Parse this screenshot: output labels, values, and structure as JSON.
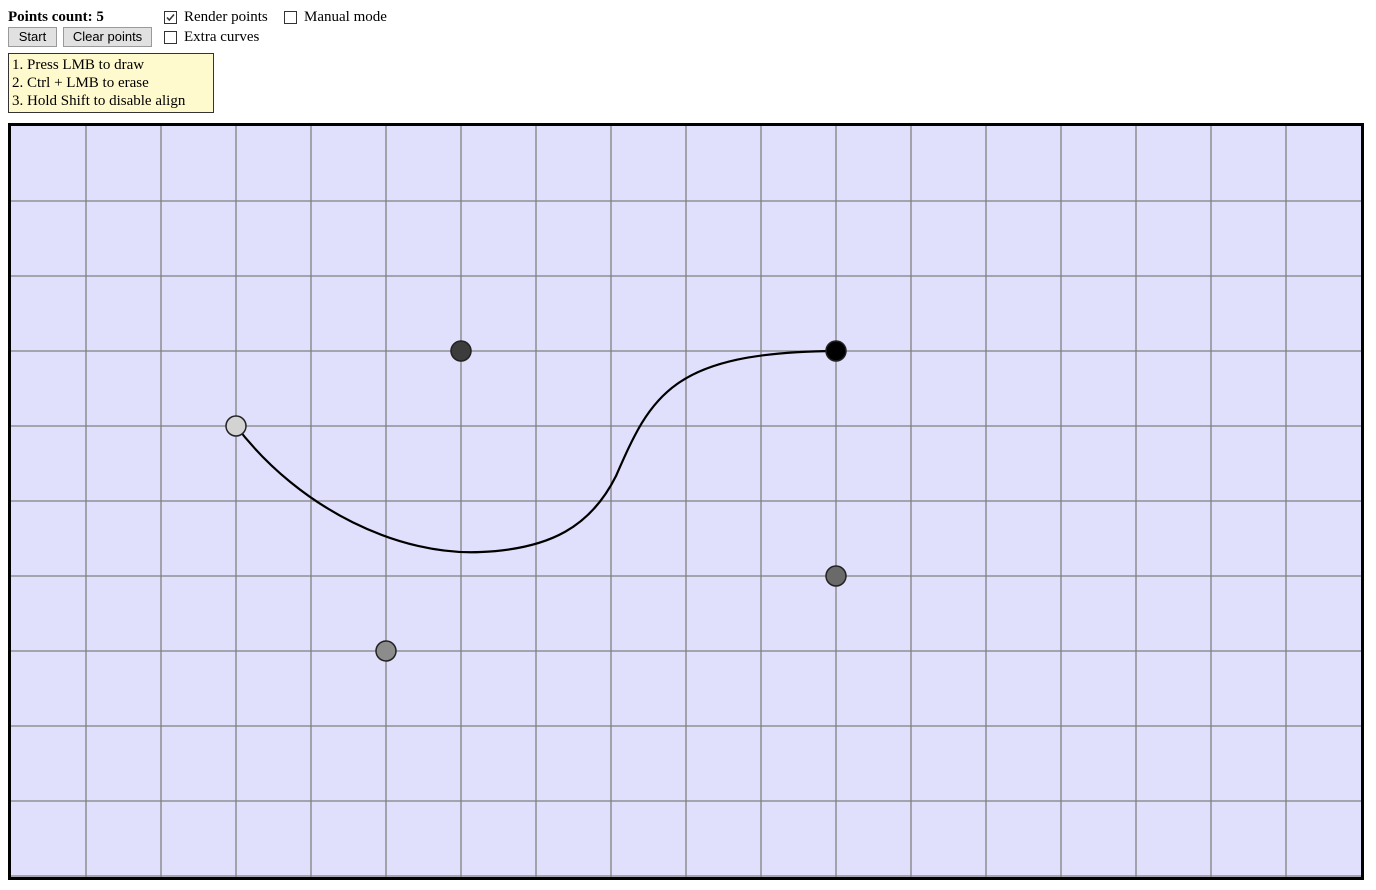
{
  "header": {
    "points_count_label": "Points count: 5"
  },
  "buttons": {
    "start_label": "Start",
    "clear_label": "Clear points"
  },
  "options": {
    "render_points": {
      "label": "Render points",
      "checked": true
    },
    "manual_mode": {
      "label": "Manual mode",
      "checked": false
    },
    "extra_curves": {
      "label": "Extra curves",
      "checked": false
    }
  },
  "hints": [
    "1. Press LMB to draw",
    "2. Ctrl + LMB to erase",
    "3. Hold Shift to disable align"
  ],
  "canvas": {
    "background_color": "#e0e0fc",
    "grid_color": "#808080",
    "curve_color": "#000000",
    "points": [
      {
        "shade": "#d3d3d3"
      },
      {
        "shade": "#8c8c8c"
      },
      {
        "shade": "#3c3c3c"
      },
      {
        "shade": "#6a6a6a"
      },
      {
        "shade": "#000000"
      }
    ]
  }
}
